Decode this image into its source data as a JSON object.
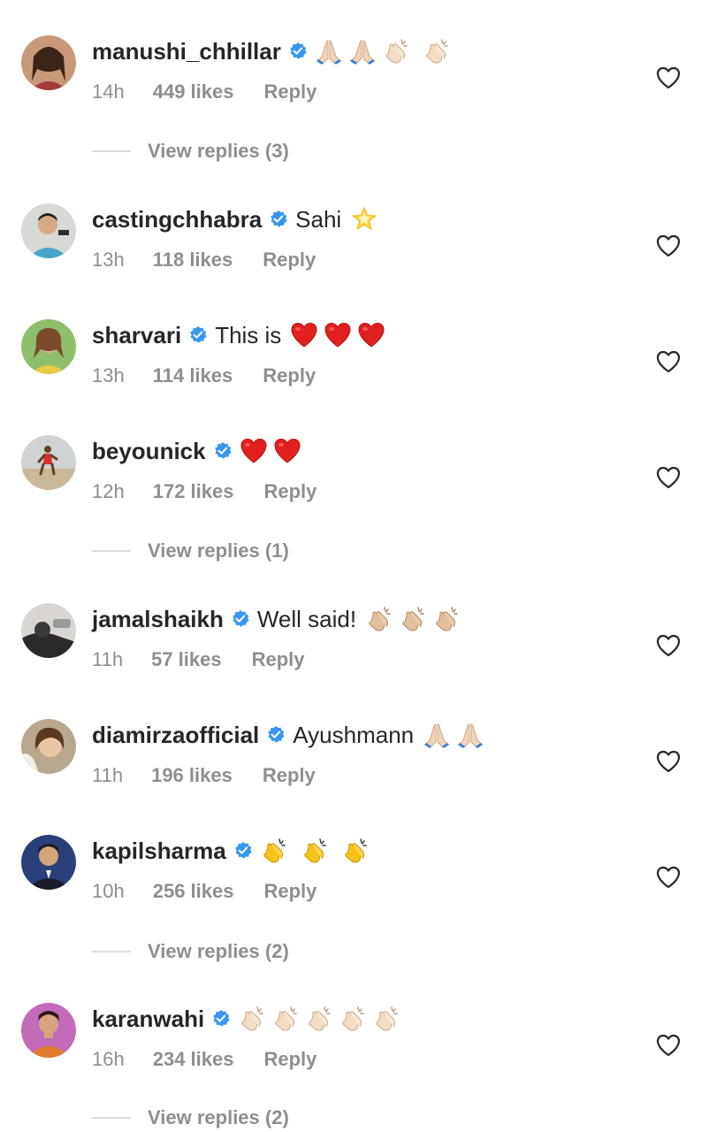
{
  "comments": [
    {
      "username": "manushi_chhillar",
      "text": "",
      "emojis": [
        "folded-hands",
        "folded-hands",
        "clapping-hands-light",
        "clapping-hands-light"
      ],
      "time": "14h",
      "likes": "449 likes",
      "reply": "Reply",
      "view_replies": "View replies (3)"
    },
    {
      "username": "castingchhabra",
      "text": "Sahi",
      "emojis": [
        "glowing-star"
      ],
      "time": "13h",
      "likes": "118 likes",
      "reply": "Reply"
    },
    {
      "username": "sharvari",
      "text": "This is",
      "emojis": [
        "red-heart",
        "red-heart",
        "red-heart"
      ],
      "time": "13h",
      "likes": "114 likes",
      "reply": "Reply"
    },
    {
      "username": "beyounick",
      "text": "",
      "emojis": [
        "red-heart",
        "red-heart"
      ],
      "time": "12h",
      "likes": "172 likes",
      "reply": "Reply",
      "view_replies": "View replies (1)"
    },
    {
      "username": "jamalshaikh",
      "text": "Well said!",
      "emojis": [
        "clapping-hands-medium",
        "clapping-hands-medium",
        "clapping-hands-medium"
      ],
      "time": "11h",
      "likes": "57 likes",
      "reply": "Reply"
    },
    {
      "username": "diamirzaofficial",
      "text": "Ayushmann",
      "emojis": [
        "folded-hands",
        "folded-hands"
      ],
      "time": "11h",
      "likes": "196 likes",
      "reply": "Reply"
    },
    {
      "username": "kapilsharma",
      "text": "",
      "emojis": [
        "clapping-hands-yellow",
        "clapping-hands-yellow",
        "clapping-hands-yellow"
      ],
      "time": "10h",
      "likes": "256 likes",
      "reply": "Reply",
      "view_replies": "View replies (2)"
    },
    {
      "username": "karanwahi",
      "text": "",
      "emojis": [
        "clapping-hands-light",
        "clapping-hands-light",
        "clapping-hands-light",
        "clapping-hands-light",
        "clapping-hands-light"
      ],
      "time": "16h",
      "likes": "234 likes",
      "reply": "Reply",
      "view_replies": "View replies (2)"
    }
  ],
  "colors": {
    "text_primary": "#262626",
    "text_secondary": "#8e8e8e",
    "verified_blue": "#3897f0",
    "divider": "#dbdbdb"
  },
  "icons": {
    "verified": "verified-badge-icon",
    "like": "heart-outline-icon"
  }
}
